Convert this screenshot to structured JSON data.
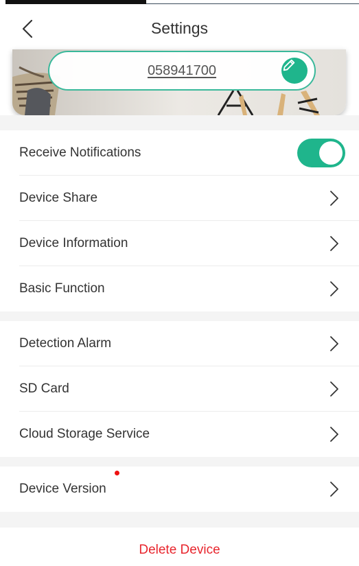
{
  "header": {
    "title": "Settings"
  },
  "device": {
    "name": "058941700"
  },
  "settings_group_1": [
    {
      "label": "Receive Notifications",
      "type": "toggle",
      "on": true
    },
    {
      "label": "Device Share",
      "type": "link"
    },
    {
      "label": "Device Information",
      "type": "link"
    },
    {
      "label": "Basic Function",
      "type": "link"
    }
  ],
  "settings_group_2": [
    {
      "label": "Detection Alarm",
      "type": "link"
    },
    {
      "label": "SD Card",
      "type": "link"
    },
    {
      "label": "Cloud Storage Service",
      "type": "link"
    }
  ],
  "settings_group_3": [
    {
      "label": "Device Version",
      "type": "link",
      "badge": "red-dot"
    }
  ],
  "actions": {
    "delete_label": "Delete Device"
  },
  "colors": {
    "accent": "#1fb58c",
    "danger": "#e8252d",
    "badge": "#ee1111",
    "separator": "#f4f4f4"
  },
  "icons": {
    "back": "chevron-left-icon",
    "edit": "pencil-icon",
    "row": "chevron-right-icon"
  }
}
